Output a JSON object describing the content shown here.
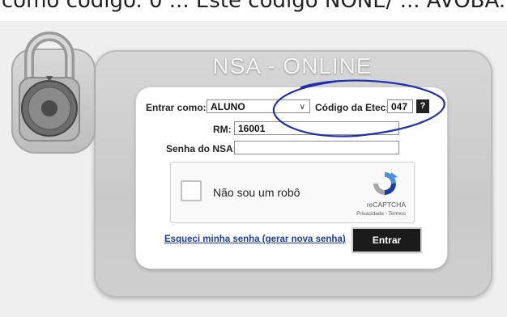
{
  "caption_top": "como código. 0 ... Este código NONE/ ... AVOBA.",
  "panel": {
    "title": "NSA - ONLINE"
  },
  "form": {
    "entrar_como_label": "Entrar como:",
    "entrar_como_value": "ALUNO",
    "codigo_label": "Código da Etec:",
    "codigo_value": "047",
    "help_label": "?",
    "rm_label": "RM:",
    "rm_value": "16001",
    "senha_label": "Senha do NSA:",
    "senha_value": ""
  },
  "captcha": {
    "label": "Não sou um robô",
    "brand": "reCAPTCHA",
    "terms": "Privacidade - Termos"
  },
  "links": {
    "forgot": "Esqueci minha senha (gerar nova senha)"
  },
  "buttons": {
    "enter": "Entrar"
  },
  "colors": {
    "annotation": "#1f2fb0",
    "link": "#1a3aa8",
    "button": "#1b1b1b"
  },
  "icons": [
    "combination-lock-icon",
    "select-chevron-icon",
    "recaptcha-logo-icon"
  ]
}
